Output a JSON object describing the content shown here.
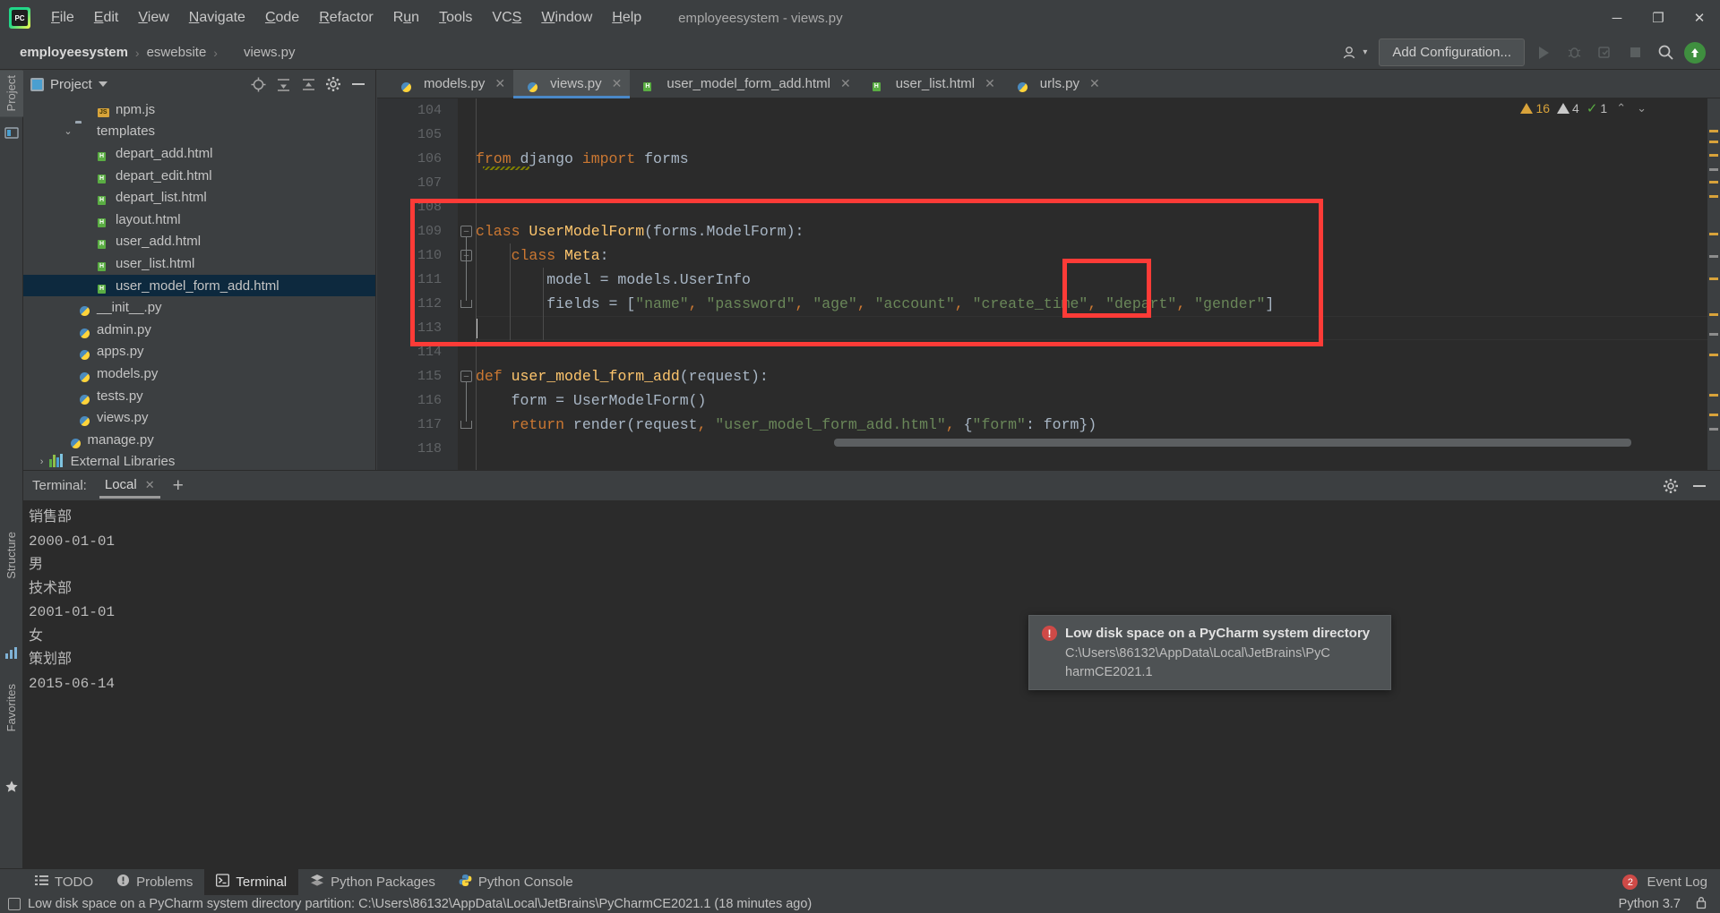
{
  "window": {
    "title": "employeesystem - views.py",
    "app_icon": "pycharm-logo",
    "minimize": "─",
    "maximize": "❐",
    "close": "✕"
  },
  "menubar": [
    {
      "label": "File",
      "accel": "F"
    },
    {
      "label": "Edit",
      "accel": "E"
    },
    {
      "label": "View",
      "accel": "V"
    },
    {
      "label": "Navigate",
      "accel": "N"
    },
    {
      "label": "Code",
      "accel": "C"
    },
    {
      "label": "Refactor",
      "accel": "R"
    },
    {
      "label": "Run",
      "accel": "u"
    },
    {
      "label": "Tools",
      "accel": "T"
    },
    {
      "label": "VCS",
      "accel": "S"
    },
    {
      "label": "Window",
      "accel": "W"
    },
    {
      "label": "Help",
      "accel": "H"
    }
  ],
  "breadcrumb": {
    "items": [
      "employeesystem",
      "eswebsite",
      "views.py"
    ],
    "separator": "›"
  },
  "navbar": {
    "add_configuration": "Add Configuration...",
    "run_icon": "run-icon",
    "debug_icon": "debug-icon",
    "coverage_icon": "coverage-icon",
    "stop_icon": "stop-icon",
    "search_icon": "search-icon",
    "update_icon": "update-arrow-icon",
    "user_icon": "user-icon"
  },
  "left_strip": {
    "project": "Project",
    "structure": "Structure",
    "favorites": "Favorites"
  },
  "project_panel": {
    "title": "Project",
    "icons": [
      "locate-icon",
      "collapse-all-icon",
      "expand-all-icon",
      "settings-gear-icon",
      "hide-icon"
    ],
    "tree": [
      {
        "label": "npm.js",
        "indent": 3,
        "icon": "js-file-icon",
        "arrow": "",
        "selected": false
      },
      {
        "label": "templates",
        "indent": 2,
        "icon": "folder-icon",
        "arrow": "⌄",
        "selected": false
      },
      {
        "label": "depart_add.html",
        "indent": 3,
        "icon": "html-file-icon",
        "arrow": "",
        "selected": false
      },
      {
        "label": "depart_edit.html",
        "indent": 3,
        "icon": "html-file-icon",
        "arrow": "",
        "selected": false
      },
      {
        "label": "depart_list.html",
        "indent": 3,
        "icon": "html-file-icon",
        "arrow": "",
        "selected": false
      },
      {
        "label": "layout.html",
        "indent": 3,
        "icon": "html-file-icon",
        "arrow": "",
        "selected": false
      },
      {
        "label": "user_add.html",
        "indent": 3,
        "icon": "html-file-icon",
        "arrow": "",
        "selected": false
      },
      {
        "label": "user_list.html",
        "indent": 3,
        "icon": "html-file-icon",
        "arrow": "",
        "selected": false
      },
      {
        "label": "user_model_form_add.html",
        "indent": 3,
        "icon": "html-file-icon",
        "arrow": "",
        "selected": true
      },
      {
        "label": "__init__.py",
        "indent": 2,
        "icon": "py-file-icon",
        "arrow": "",
        "selected": false
      },
      {
        "label": "admin.py",
        "indent": 2,
        "icon": "py-file-icon",
        "arrow": "",
        "selected": false
      },
      {
        "label": "apps.py",
        "indent": 2,
        "icon": "py-file-icon",
        "arrow": "",
        "selected": false
      },
      {
        "label": "models.py",
        "indent": 2,
        "icon": "py-file-icon",
        "arrow": "",
        "selected": false
      },
      {
        "label": "tests.py",
        "indent": 2,
        "icon": "py-file-icon",
        "arrow": "",
        "selected": false
      },
      {
        "label": "views.py",
        "indent": 2,
        "icon": "py-file-icon",
        "arrow": "",
        "selected": false
      },
      {
        "label": "manage.py",
        "indent": 1.5,
        "icon": "py-file-icon",
        "arrow": "",
        "selected": false
      },
      {
        "label": "External Libraries",
        "indent": 0.6,
        "icon": "library-icon",
        "arrow": "›",
        "selected": false
      }
    ]
  },
  "editor_tabs": [
    {
      "label": "models.py",
      "icon": "py-file-icon",
      "active": false,
      "close": "✕"
    },
    {
      "label": "views.py",
      "icon": "py-file-icon",
      "active": true,
      "close": "✕"
    },
    {
      "label": "user_model_form_add.html",
      "icon": "html-file-icon",
      "active": false,
      "close": "✕"
    },
    {
      "label": "user_list.html",
      "icon": "html-file-icon",
      "active": false,
      "close": "✕"
    },
    {
      "label": "urls.py",
      "icon": "py-file-icon",
      "active": false,
      "close": "✕"
    }
  ],
  "inspections": {
    "warnings": "16",
    "weak_warnings": "4",
    "ok": "1",
    "up": "⌃",
    "down": "⌄"
  },
  "code": {
    "lines": [
      {
        "num": "104",
        "text": ""
      },
      {
        "num": "105",
        "text": ""
      },
      {
        "num": "106",
        "text": "from django import forms"
      },
      {
        "num": "107",
        "text": ""
      },
      {
        "num": "108",
        "text": ""
      },
      {
        "num": "109",
        "text": "class UserModelForm(forms.ModelForm):"
      },
      {
        "num": "110",
        "text": "    class Meta:"
      },
      {
        "num": "111",
        "text": "        model = models.UserInfo"
      },
      {
        "num": "112",
        "text": "        fields = [\"name\", \"password\", \"age\", \"account\", \"create_time\", \"depart\", \"gender\"]"
      },
      {
        "num": "113",
        "text": ""
      },
      {
        "num": "114",
        "text": ""
      },
      {
        "num": "115",
        "text": "def user_model_form_add(request):"
      },
      {
        "num": "116",
        "text": "    form = UserModelForm()"
      },
      {
        "num": "117",
        "text": "    return render(request, \"user_model_form_add.html\", {\"form\": form})"
      },
      {
        "num": "118",
        "text": ""
      }
    ],
    "cursor_line": "113"
  },
  "annotations": {
    "outer_box_color": "#fd3b37",
    "inner_box_color": "#fd3b37",
    "inner_box_target": "\"depart\""
  },
  "terminal": {
    "label": "Terminal:",
    "tab": "Local",
    "close": "✕",
    "add": "+",
    "settings_icon": "gear-icon",
    "hide_icon": "hide-icon",
    "output": [
      "销售部",
      "2000-01-01",
      "男",
      "技术部",
      "2001-01-01",
      "女",
      "策划部",
      "2015-06-14"
    ]
  },
  "notification": {
    "icon": "error-icon",
    "title": "Low disk space on a PyCharm system directory",
    "line1": "C:\\Users\\86132\\AppData\\Local\\JetBrains\\PyC",
    "line2": "harmCE2021.1"
  },
  "bottom_bar": {
    "tabs": [
      {
        "label": "TODO",
        "icon": "todo-icon",
        "selected": false
      },
      {
        "label": "Problems",
        "icon": "problems-icon",
        "selected": false
      },
      {
        "label": "Terminal",
        "icon": "terminal-icon",
        "selected": true
      },
      {
        "label": "Python Packages",
        "icon": "packages-icon",
        "selected": false
      },
      {
        "label": "Python Console",
        "icon": "python-console-icon",
        "selected": false
      }
    ],
    "event_log": "Event Log",
    "event_count": "2"
  },
  "statusbar": {
    "message": "Low disk space on a PyCharm system directory partition: C:\\Users\\86132\\AppData\\Local\\JetBrains\\PyCharmCE2021.1 (18 minutes ago)",
    "interpreter": "Python 3.7",
    "lock_icon": "lock-icon",
    "status_icon": "status-icon"
  }
}
